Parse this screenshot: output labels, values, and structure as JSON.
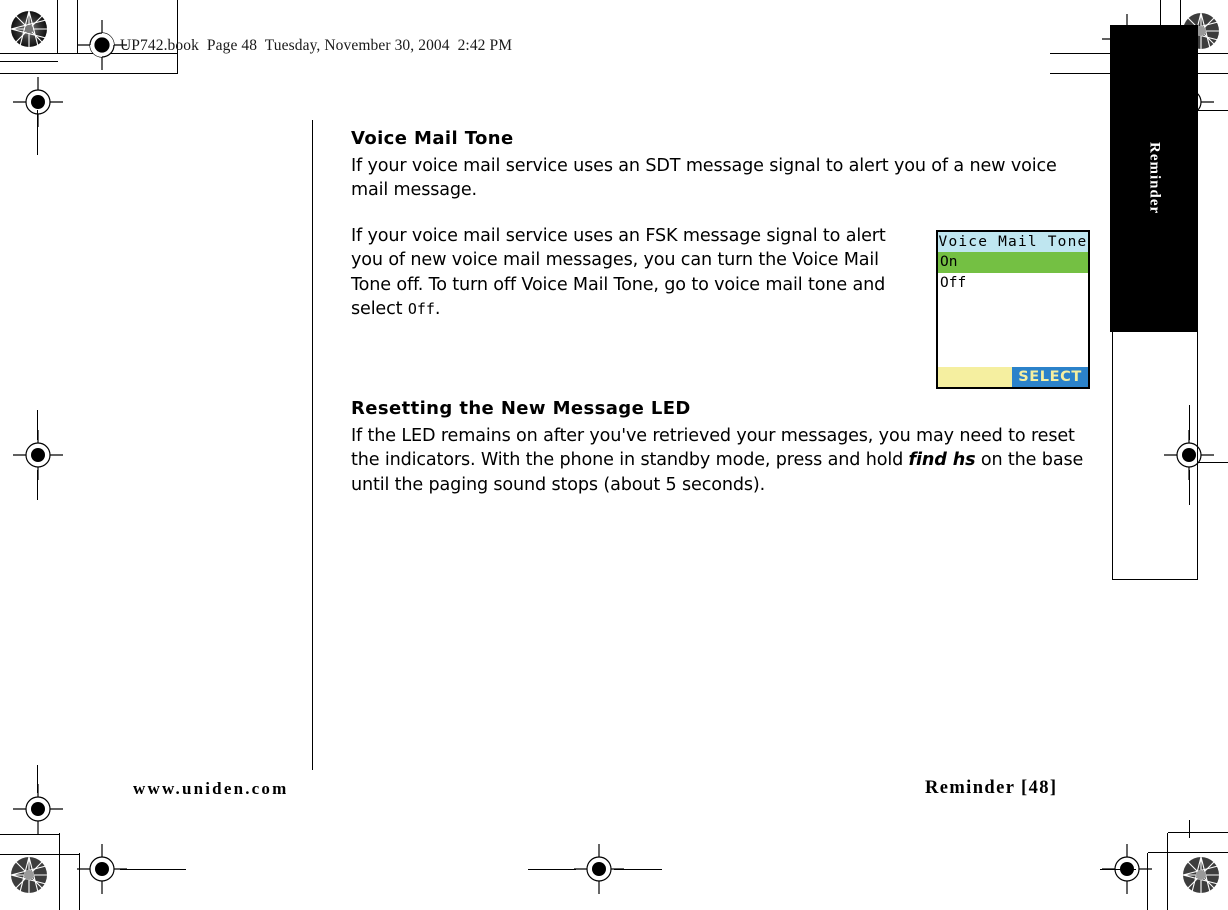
{
  "header": {
    "filename": "UP742.book",
    "page_label": "Page 48",
    "timestamp": "Tuesday, November 30, 2004  2:42 PM",
    "full": "UP742.book  Page 48  Tuesday, November 30, 2004  2:42 PM"
  },
  "sidebar": {
    "tab_label": "Reminder"
  },
  "sections": [
    {
      "heading": "Voice Mail Tone",
      "paragraph1": "If your voice mail service uses an SDT message signal to alert you of a new voice mail message.",
      "paragraph2_part1": "If your voice mail service uses an FSK message signal to alert you of new voice mail messages, you can turn the Voice Mail Tone off. To turn off Voice Mail Tone, go to voice mail tone and select ",
      "paragraph2_lcdword": "Off",
      "paragraph2_part2": "."
    },
    {
      "heading": "Resetting the New Message LED",
      "paragraph1_part1": "If the LED remains on after you've retrieved your messages, you may need to reset the indicators. With the phone in standby mode, press and hold ",
      "paragraph1_emphasis": "find hs",
      "paragraph1_part2": " on the base until the paging sound stops (about 5 seconds)."
    }
  ],
  "lcd": {
    "title": "Voice Mail Tone",
    "options": [
      {
        "label": "On",
        "selected": true
      },
      {
        "label": "Off",
        "selected": false
      }
    ],
    "softkey_right": "SELECT",
    "colors": {
      "title_bg": "#bfe6f0",
      "selected_bg": "#74c043",
      "softkey_left_bg": "#f5efa0",
      "softkey_right_bg": "#2b82ca",
      "softkey_right_text": "#f5efa0"
    }
  },
  "footer": {
    "website": "www.uniden.com",
    "page_ref": "Reminder [48]"
  }
}
